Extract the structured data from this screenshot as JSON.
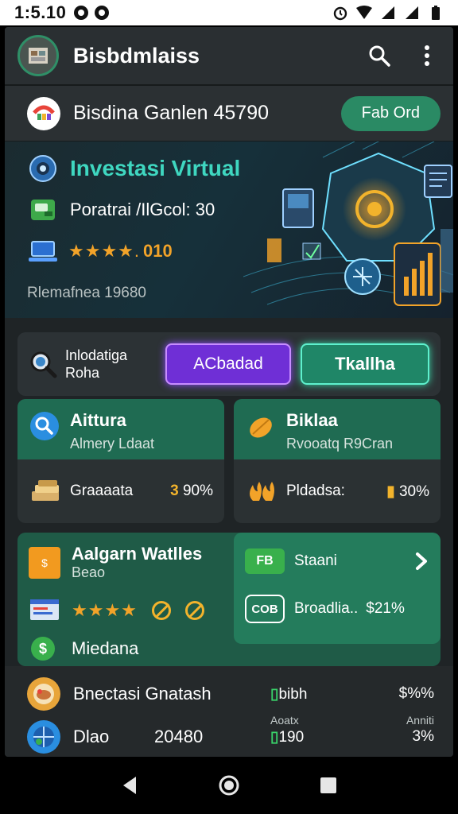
{
  "status_bar": {
    "time": "1:5.10"
  },
  "app_bar": {
    "title": "Bisbdmlaiss"
  },
  "account": {
    "text": "Bisdina Ganlen 45790",
    "button_label": "Fab Ord"
  },
  "hero": {
    "title": "Investasi Virtual",
    "line1": "Poratrai /IlGcol: 30",
    "stars": "★★★★.",
    "rating": "010",
    "footer": "Rlemafnea 19680"
  },
  "actions": {
    "label_line1": "Inlodatiga",
    "label_line2": "Roha",
    "primary_label": "ACbadad",
    "secondary_label": "Tkallha"
  },
  "cards": [
    {
      "title": "Aittura",
      "subtitle": "Almery Ldaat",
      "body_label": "Graaaata",
      "value_icon": "3",
      "value": "90%"
    },
    {
      "title": "Biklaa",
      "subtitle": "Rvooatq R9Cran",
      "body_label": "Pldadsa:",
      "value_icon": "▮",
      "value": "30%"
    }
  ],
  "panel": {
    "title": "Aalgarn Watlles",
    "subtitle": "Beao",
    "stars": "★★★★",
    "row3": "Miedana",
    "right_row1_badge": "FB",
    "right_row1_text": "Staani",
    "right_row2_badge": "COB",
    "right_row2_text": "Broadlia..",
    "right_row2_value": "$21%"
  },
  "list": [
    {
      "title": "Bnectasi Gnatash",
      "mid": "bibh",
      "right": "$%%",
      "mid_caption": "Aoatx",
      "right_caption": "Anniti"
    },
    {
      "title": "Dlao",
      "value": "20480",
      "mid": "190",
      "right": "3%"
    }
  ],
  "colors": {
    "accent_teal": "#3fd7c0",
    "brand_green": "#2a8a64",
    "gold": "#f2b32c",
    "purple": "#6f2fd6"
  }
}
